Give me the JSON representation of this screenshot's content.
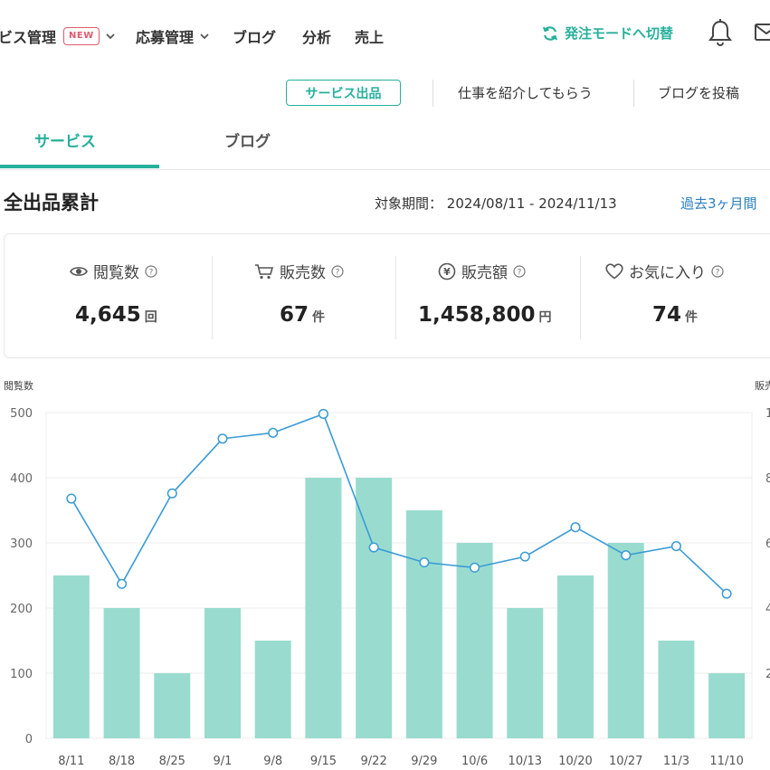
{
  "nav": {
    "items": [
      {
        "label": "ビス管理",
        "badge": "NEW",
        "dropdown": true
      },
      {
        "label": "応募管理",
        "dropdown": true
      },
      {
        "label": "ブログ"
      },
      {
        "label": "分析"
      },
      {
        "label": "売上"
      }
    ],
    "switch_mode": "発注モードへ切替"
  },
  "subbar": {
    "service_button": "サービス出品",
    "intro_link": "仕事を紹介してもらう",
    "blog_post_link": "ブログを投稿"
  },
  "tabs": [
    {
      "label": "サービス",
      "active": true
    },
    {
      "label": "ブログ",
      "active": false
    }
  ],
  "summary": {
    "title": "全出品累計",
    "period_label": "対象期間：",
    "period_range": "2024/08/11 - 2024/11/13",
    "period_link": "過去3ヶ月間",
    "stats": [
      {
        "icon": "eye-icon",
        "label": "閲覧数",
        "value": "4,645",
        "unit": "回"
      },
      {
        "icon": "cart-icon",
        "label": "販売数",
        "value": "67",
        "unit": "件"
      },
      {
        "icon": "yen-icon",
        "label": "販売額",
        "value": "1,458,800",
        "unit": "円"
      },
      {
        "icon": "heart-icon",
        "label": "お気に入り",
        "value": "74",
        "unit": "件"
      }
    ]
  },
  "colors": {
    "accent": "#27b09b",
    "bar": "#99dccf",
    "line": "#3a9bd5",
    "badge": "#e05a6e",
    "link": "#2a7fc0"
  },
  "chart_data": {
    "type": "bar",
    "categories": [
      "8/11",
      "8/18",
      "8/25",
      "9/1",
      "9/8",
      "9/15",
      "9/22",
      "9/29",
      "10/6",
      "10/13",
      "10/20",
      "10/27",
      "11/3",
      "11/10"
    ],
    "y_left_label": "閲覧数",
    "y_left_ticks": [
      "0",
      "100",
      "200",
      "300",
      "400",
      "500"
    ],
    "y_left_lim": [
      0,
      500
    ],
    "y_right_label": "販売",
    "y_right_ticks": [
      "2",
      "4",
      "6",
      "8",
      "1"
    ],
    "y_right_lim": [
      0,
      10
    ],
    "series": [
      {
        "type": "bar",
        "axis": "right",
        "values": [
          5,
          4,
          2,
          4,
          3,
          8,
          8,
          7,
          6,
          4,
          5,
          6,
          3,
          2
        ]
      },
      {
        "type": "line",
        "axis": "left",
        "values": [
          368,
          237,
          376,
          460,
          469,
          498,
          293,
          270,
          262,
          279,
          324,
          281,
          295,
          222
        ]
      }
    ],
    "grid": true
  }
}
